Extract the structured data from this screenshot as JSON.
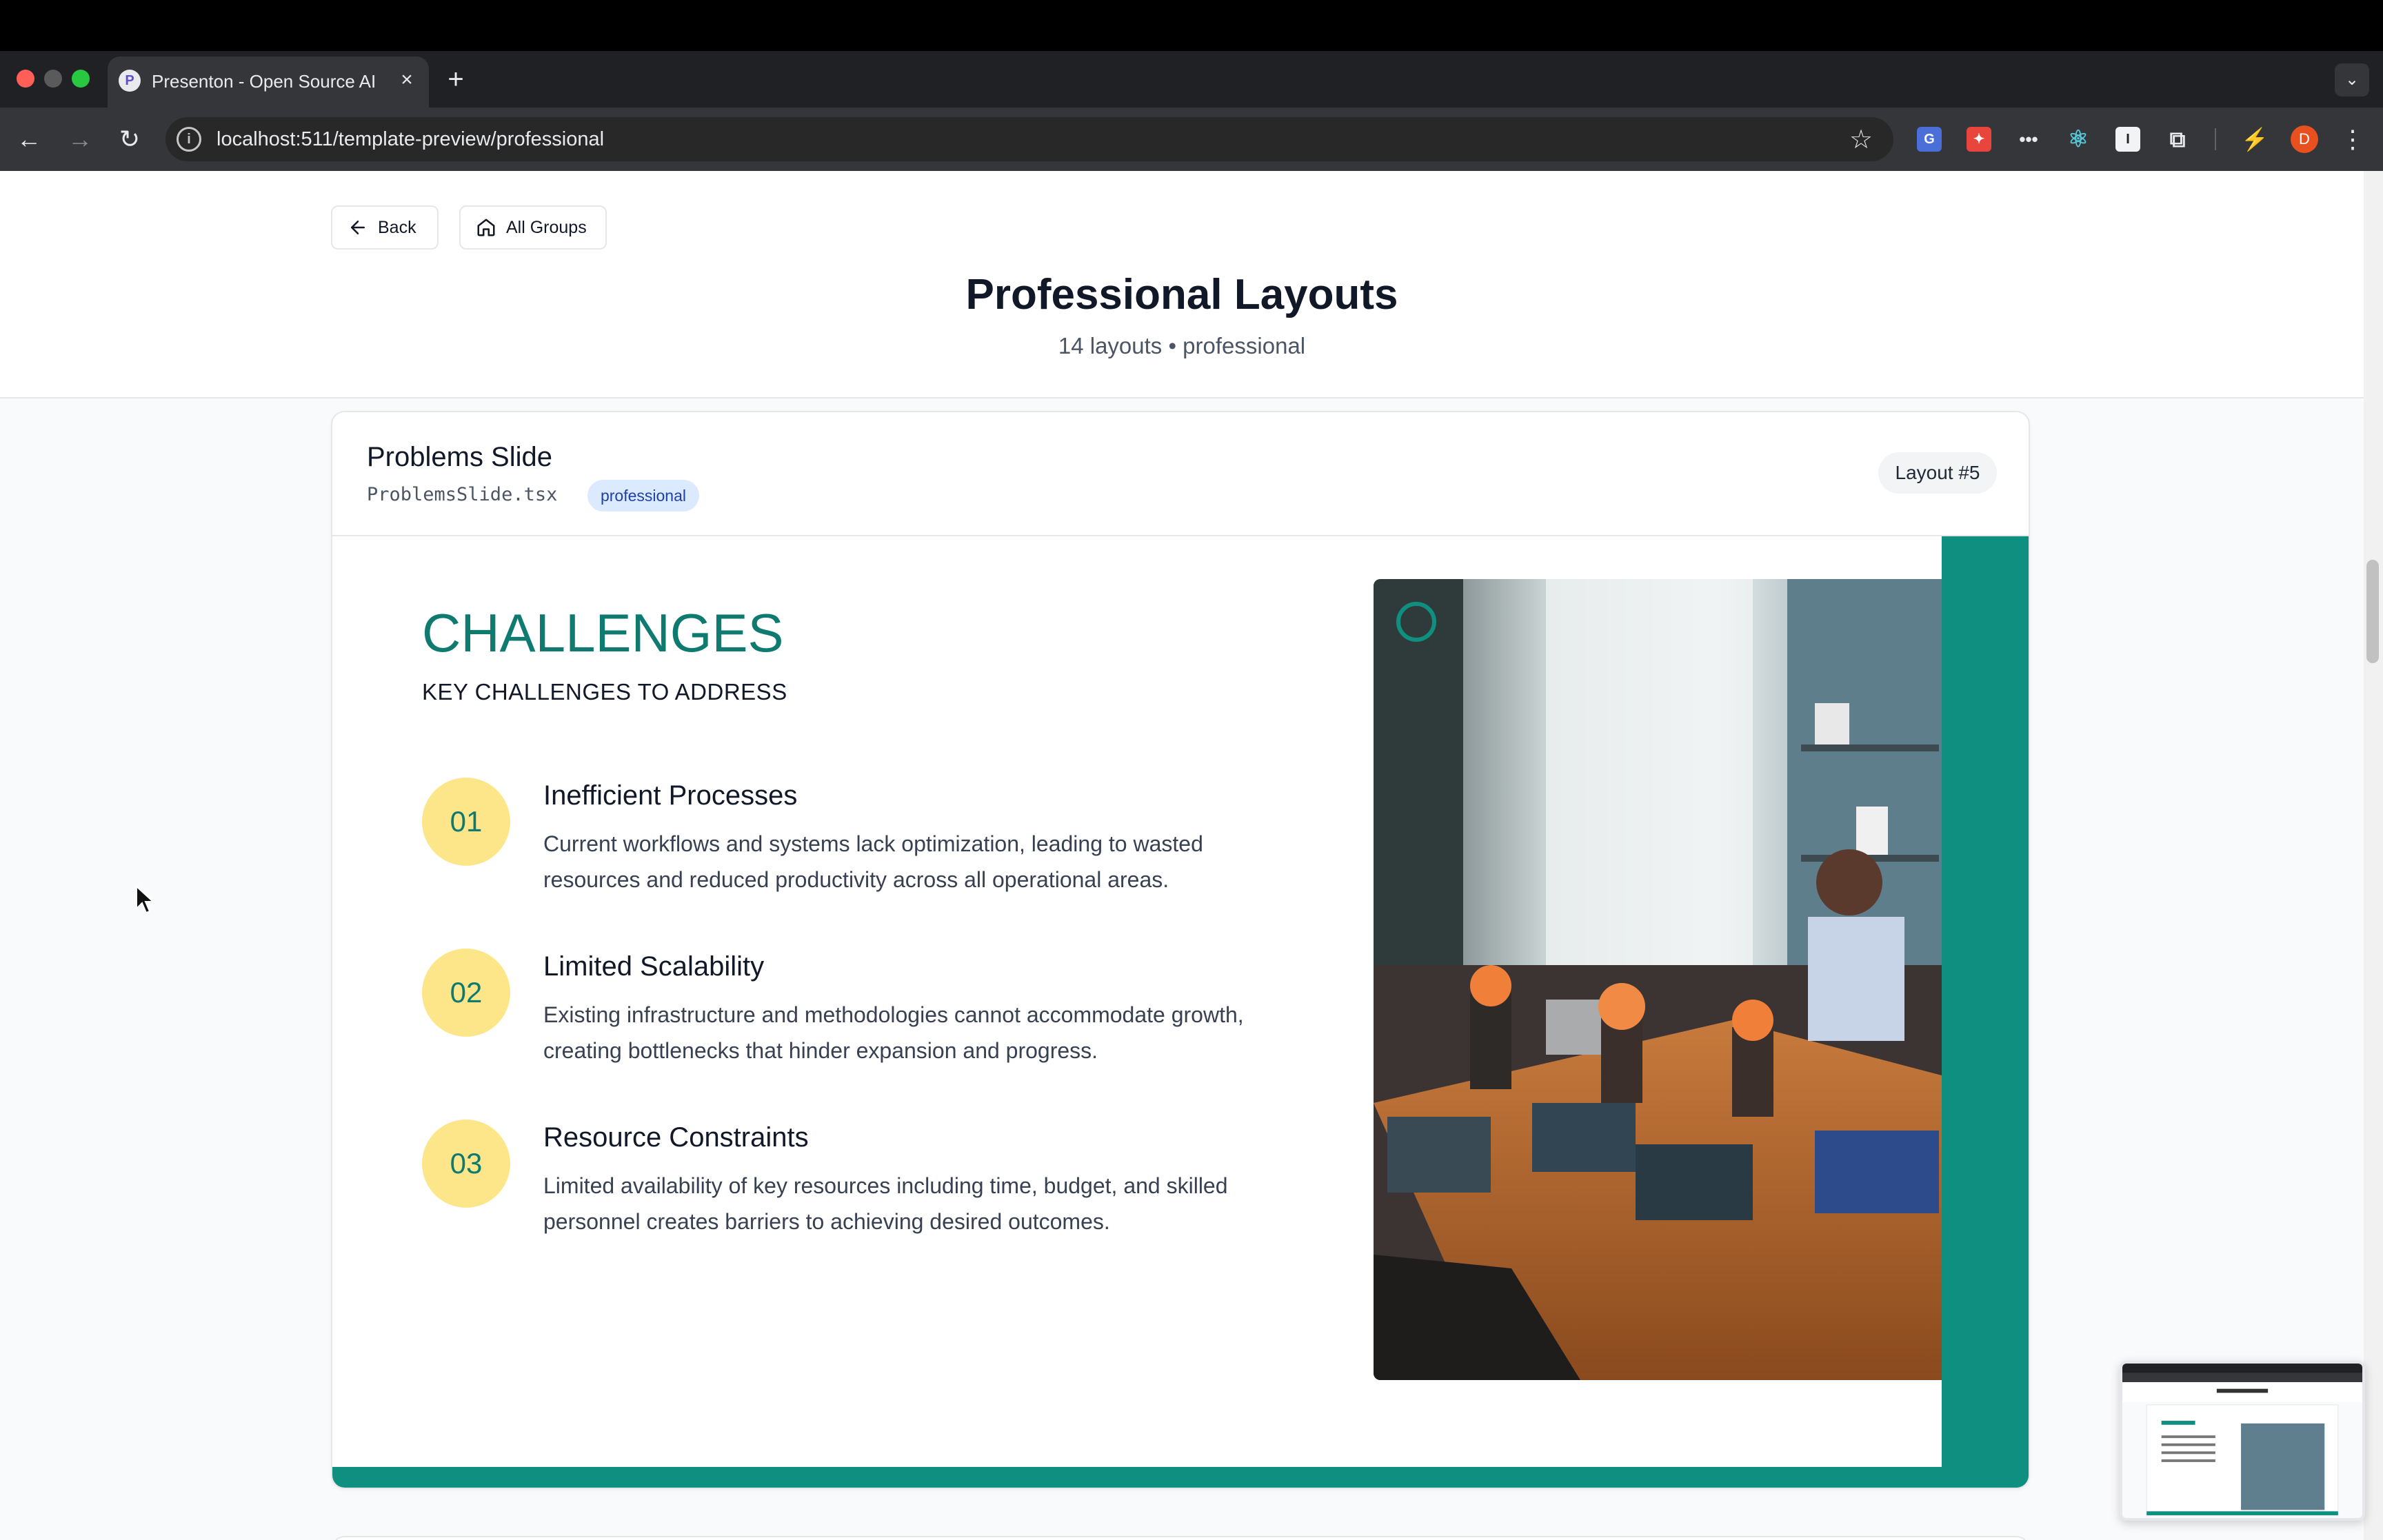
{
  "browser": {
    "tab_title": "Presenton - Open Source AI p",
    "tab_favicon": "P",
    "url": "localhost:511/template-preview/professional",
    "profile_initial": "D",
    "icons": [
      "back-arrow-icon",
      "forward-arrow-icon",
      "reload-icon",
      "site-info-icon",
      "star-icon",
      "extensions-icon",
      "kebab-menu-icon"
    ]
  },
  "header": {
    "back_label": "Back",
    "all_groups_label": "All Groups",
    "title": "Professional Layouts",
    "subtitle": "14 layouts • professional"
  },
  "card": {
    "title": "Problems Slide",
    "file": "ProblemsSlide.tsx",
    "tag": "professional",
    "layout_badge": "Layout #5"
  },
  "slide": {
    "heading": "CHALLENGES",
    "subheading": "KEY CHALLENGES TO ADDRESS",
    "items": [
      {
        "number": "01",
        "title": "Inefficient Processes",
        "desc_line1": "Current workflows and systems lack optimization, leading to wasted",
        "desc_line2": "resources and reduced productivity across all operational areas."
      },
      {
        "number": "02",
        "title": "Limited Scalability",
        "desc_line1": "Existing infrastructure and methodologies cannot accommodate growth,",
        "desc_line2": "creating bottlenecks that hinder expansion and progress."
      },
      {
        "number": "03",
        "title": "Resource Constraints",
        "desc_line1": "Limited availability of key resources including time, budget, and skilled",
        "desc_line2": "personnel creates barriers to achieving desired outcomes."
      }
    ],
    "accent_color": "#0f8f80",
    "number_bg_color": "#fde68a"
  }
}
